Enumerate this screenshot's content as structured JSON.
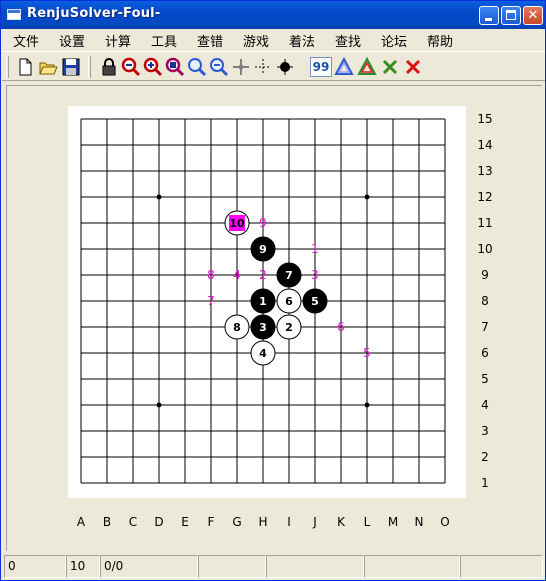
{
  "window": {
    "title": "RenjuSolver-Foul-"
  },
  "menu": [
    "文件",
    "设置",
    "计算",
    "工具",
    "查错",
    "游戏",
    "着法",
    "查找",
    "论坛",
    "帮助"
  ],
  "toolbar": {
    "tools": [
      "new-file-icon",
      "open-folder-icon",
      "save-disk-icon",
      "lock-icon",
      "zoom-in-red-1-icon",
      "zoom-in-red-2-icon",
      "zoom-in-red-3-icon",
      "zoom-in-icon",
      "zoom-out-icon",
      "crosshair-icon",
      "dotted-cross-icon",
      "black-stone-icon"
    ],
    "move_number_label": "99",
    "tools_after": [
      "tree-blue-icon",
      "tree-green-icon",
      "cross-green-icon",
      "cross-red-icon"
    ]
  },
  "board": {
    "columns": [
      "A",
      "B",
      "C",
      "D",
      "E",
      "F",
      "G",
      "H",
      "I",
      "J",
      "K",
      "L",
      "M",
      "N",
      "O"
    ],
    "rows": [
      "15",
      "14",
      "13",
      "12",
      "11",
      "10",
      "9",
      "8",
      "7",
      "6",
      "5",
      "4",
      "3",
      "2",
      "1"
    ],
    "star_points": [
      "D12",
      "L12",
      "D4",
      "L4"
    ],
    "stones": [
      {
        "move": "1",
        "color": "black",
        "pos": "H8"
      },
      {
        "move": "2",
        "color": "white",
        "pos": "I7"
      },
      {
        "move": "3",
        "color": "black",
        "pos": "H7"
      },
      {
        "move": "4",
        "color": "white",
        "pos": "H6"
      },
      {
        "move": "5",
        "color": "black",
        "pos": "J8"
      },
      {
        "move": "6",
        "color": "white",
        "pos": "I8"
      },
      {
        "move": "7",
        "color": "black",
        "pos": "I9"
      },
      {
        "move": "8",
        "color": "white",
        "pos": "G7"
      },
      {
        "move": "9",
        "color": "black",
        "pos": "H10"
      },
      {
        "move": "10",
        "color": "white",
        "pos": "G11",
        "last": true
      }
    ],
    "candidate_marks": [
      {
        "label": "1",
        "pos": "J10"
      },
      {
        "label": "2",
        "pos": "H9"
      },
      {
        "label": "3",
        "pos": "J9"
      },
      {
        "label": "4",
        "pos": "G9"
      },
      {
        "label": "5",
        "pos": "L6"
      },
      {
        "label": "6",
        "pos": "K7"
      },
      {
        "label": "7",
        "pos": "F8"
      },
      {
        "label": "8",
        "pos": "F9"
      },
      {
        "label": "9",
        "pos": "H11"
      }
    ],
    "colors": {
      "mark": "#e010c8",
      "last_move_fill": "#ff00ff",
      "line": "#000000"
    }
  },
  "statusbar": [
    "0",
    "10",
    "0/0",
    "",
    "",
    "",
    ""
  ]
}
